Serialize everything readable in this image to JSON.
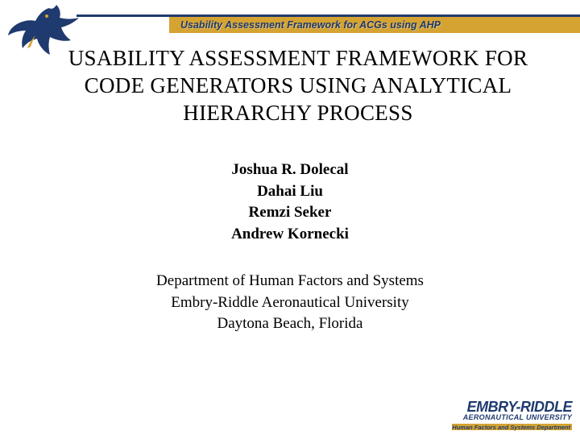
{
  "header": {
    "banner": "Usability Assessment Framework for ACGs using AHP"
  },
  "title": "USABILITY ASSESSMENT FRAMEWORK FOR CODE GENERATORS USING ANALYTICAL HIERARCHY PROCESS",
  "authors": [
    "Joshua R. Dolecal",
    "Dahai Liu",
    "Remzi Seker",
    "Andrew Kornecki"
  ],
  "affiliation": [
    "Department of Human Factors and Systems",
    "Embry-Riddle Aeronautical University",
    "Daytona Beach, Florida"
  ],
  "footer": {
    "brand": "EMBRY-RIDDLE",
    "sub1": "AERONAUTICAL UNIVERSITY",
    "sub2": "Human Factors and Systems Department"
  }
}
